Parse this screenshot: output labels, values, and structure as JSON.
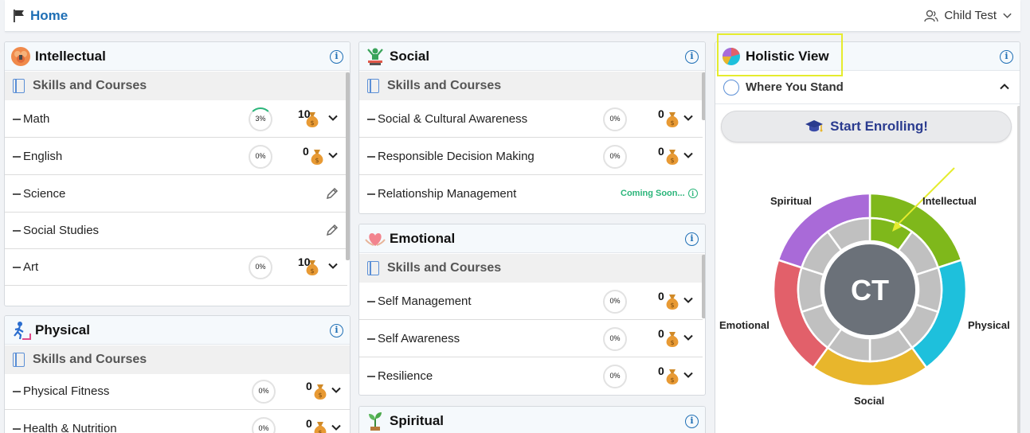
{
  "topbar": {
    "home": "Home",
    "user": "Child Test"
  },
  "intellectual": {
    "title": "Intellectual",
    "sub": "Skills and Courses",
    "rows": [
      {
        "label": "Math",
        "progress": "3%",
        "coins": "10"
      },
      {
        "label": "English",
        "progress": "0%",
        "coins": "0"
      },
      {
        "label": "Science"
      },
      {
        "label": "Social Studies"
      },
      {
        "label": "Art",
        "progress": "0%",
        "coins": "10"
      }
    ]
  },
  "physical": {
    "title": "Physical",
    "sub": "Skills and Courses",
    "rows": [
      {
        "label": "Physical Fitness",
        "progress": "0%",
        "coins": "0"
      },
      {
        "label": "Health & Nutrition",
        "progress": "0%",
        "coins": "0"
      }
    ]
  },
  "social": {
    "title": "Social",
    "sub": "Skills and Courses",
    "rows": [
      {
        "label": "Social & Cultural Awareness",
        "progress": "0%",
        "coins": "0"
      },
      {
        "label": "Responsible Decision Making",
        "progress": "0%",
        "coins": "0"
      },
      {
        "label": "Relationship Management",
        "status": "Coming Soon..."
      }
    ]
  },
  "emotional": {
    "title": "Emotional",
    "sub": "Skills and Courses",
    "rows": [
      {
        "label": "Self Management",
        "progress": "0%",
        "coins": "0"
      },
      {
        "label": "Self Awareness",
        "progress": "0%",
        "coins": "0"
      },
      {
        "label": "Resilience",
        "progress": "0%",
        "coins": "0"
      }
    ]
  },
  "spiritual": {
    "title": "Spiritual"
  },
  "holistic": {
    "title": "Holistic View",
    "where": "Where You Stand",
    "enroll": "Start Enrolling!",
    "initials": "CT",
    "segments": {
      "intellectual": "Intellectual",
      "physical": "Physical",
      "social": "Social",
      "emotional": "Emotional",
      "spiritual": "Spiritual"
    },
    "colors": {
      "intellectual": "#7fb81b",
      "physical": "#1ec0dc",
      "social": "#e8b62c",
      "emotional": "#e2606a",
      "spiritual": "#a96ad8",
      "center": "#6b7179",
      "inner": "#c0c0c0",
      "filled": "#7fb81b"
    }
  }
}
